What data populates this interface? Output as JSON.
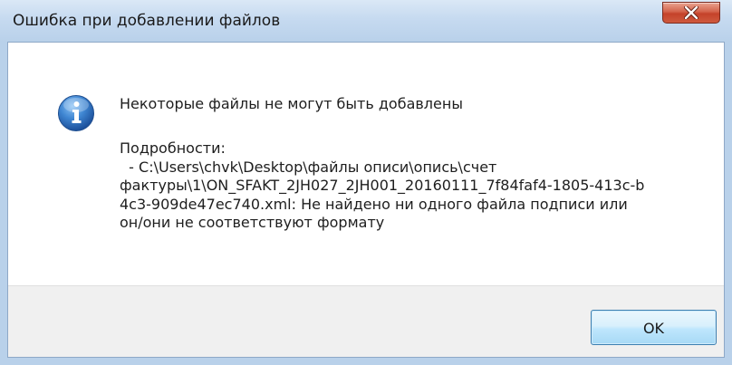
{
  "dialog": {
    "title": "Ошибка при добавлении файлов",
    "close_icon": "close-icon",
    "message_icon": "info-icon",
    "message": "Некоторые файлы не могут быть добавлены",
    "details_label": "Подробности:",
    "details_lines": [
      "  - C:\\Users\\chvk\\Desktop\\файлы описи\\опись\\счет",
      "фактуры\\1\\ON_SFAKT_2JH027_2JH001_20160111_7f84faf4-1805-413c-b",
      "4c3-909de47ec740.xml: Не найдено ни одного файла подписи или",
      "он/они не соответствуют формату"
    ],
    "ok_label": "OK"
  },
  "colors": {
    "titlebar": "#b9d1ea",
    "close_button": "#c4422a",
    "footer": "#f0f0f0",
    "ok_button_border": "#3c7fb1",
    "info_icon": "#2f74c0"
  }
}
